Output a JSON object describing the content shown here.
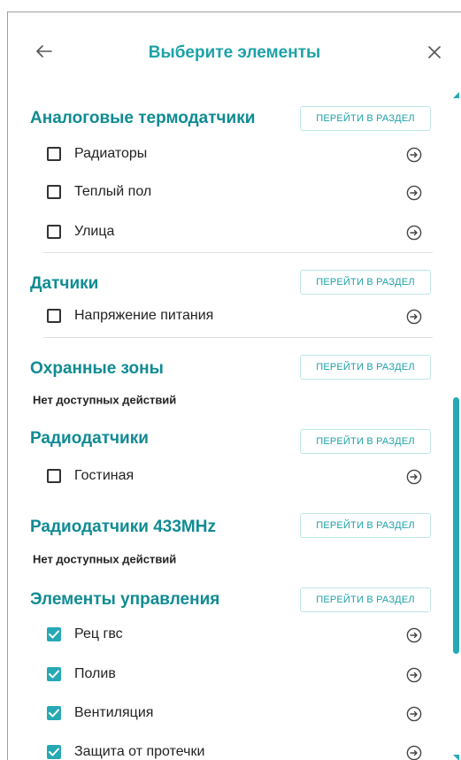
{
  "header": {
    "title": "Выберите элементы",
    "back_icon": "arrow-left-icon",
    "close_icon": "close-icon"
  },
  "goto_label": "ПЕРЕЙТИ В РАЗДЕЛ",
  "empty_text": "Нет доступных действий",
  "sections": [
    {
      "title": "Аналоговые термодатчики",
      "items": [
        {
          "label": "Радиаторы",
          "checked": false
        },
        {
          "label": "Теплый пол",
          "checked": false
        },
        {
          "label": "Улица",
          "checked": false
        }
      ]
    },
    {
      "title": "Датчики",
      "items": [
        {
          "label": "Напряжение питания",
          "checked": false
        }
      ]
    },
    {
      "title": "Охранные зоны",
      "items": []
    },
    {
      "title": "Радиодатчики",
      "items": [
        {
          "label": "Гостиная",
          "checked": false
        }
      ]
    },
    {
      "title": "Радиодатчики 433MHz",
      "items": []
    },
    {
      "title": "Элементы управления",
      "items": [
        {
          "label": "Рец гвс",
          "checked": true
        },
        {
          "label": "Полив",
          "checked": true
        },
        {
          "label": "Вентиляция",
          "checked": true
        },
        {
          "label": "Защита от протечки",
          "checked": true
        }
      ]
    }
  ],
  "colors": {
    "title": "#1ea2a8",
    "section_title": "#108b93",
    "checked": "#27a9b5",
    "scroll_thumb": "#27a9b5"
  }
}
